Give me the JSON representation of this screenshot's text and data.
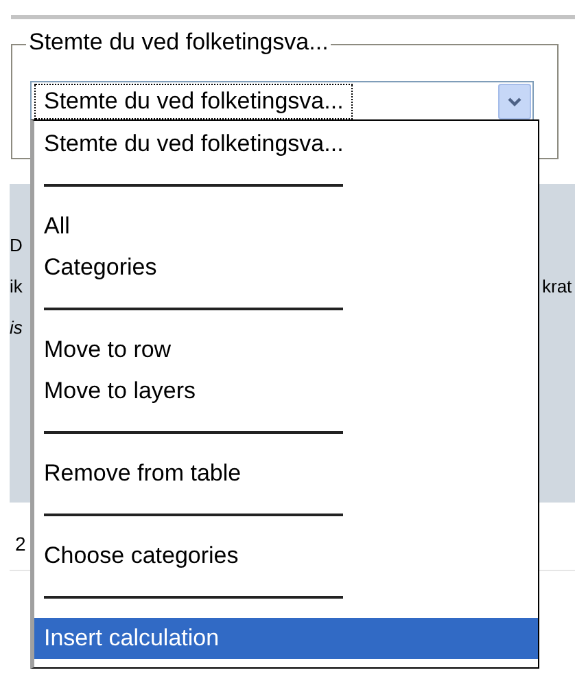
{
  "fieldset": {
    "legend": "Stemte du ved folketingsva..."
  },
  "select": {
    "value": "Stemte du ved folketingsva..."
  },
  "dropdown": {
    "items": [
      {
        "kind": "option",
        "label": "Stemte du ved folketingsva...",
        "selected": false
      },
      {
        "kind": "separator"
      },
      {
        "kind": "option",
        "label": "All",
        "selected": false
      },
      {
        "kind": "option",
        "label": "Categories",
        "selected": false
      },
      {
        "kind": "separator"
      },
      {
        "kind": "option",
        "label": "Move to row",
        "selected": false
      },
      {
        "kind": "option",
        "label": "Move to layers",
        "selected": false
      },
      {
        "kind": "separator"
      },
      {
        "kind": "option",
        "label": "Remove from table",
        "selected": false
      },
      {
        "kind": "separator"
      },
      {
        "kind": "option",
        "label": "Choose categories",
        "selected": false
      },
      {
        "kind": "separator"
      },
      {
        "kind": "option",
        "label": "Insert calculation",
        "selected": true
      }
    ]
  },
  "table": {
    "header_left": [
      "D",
      "ik",
      "is"
    ],
    "header_right": "krat",
    "row_label": "2"
  }
}
